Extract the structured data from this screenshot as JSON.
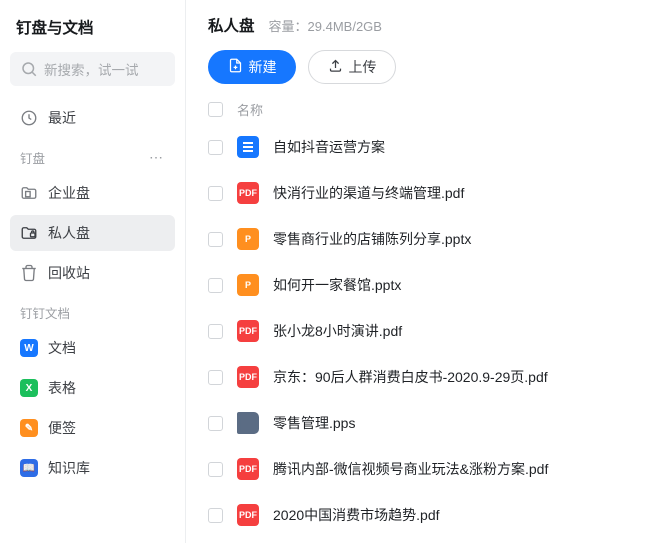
{
  "app_title": "钉盘与文档",
  "search": {
    "placeholder": "新搜索，试一试"
  },
  "nav_recent": "最近",
  "section_drive": "钉盘",
  "nav_enterprise": "企业盘",
  "nav_personal": "私人盘",
  "nav_trash": "回收站",
  "section_docs": "钉钉文档",
  "doc_docs": "文档",
  "doc_sheets": "表格",
  "doc_notes": "便签",
  "doc_wiki": "知识库",
  "main_title": "私人盘",
  "capacity_label": "容量：",
  "capacity_value": "29.4MB/2GB",
  "btn_new": "新建",
  "btn_upload": "上传",
  "col_name": "名称",
  "files": [
    {
      "type": "doc",
      "badge": "",
      "name": "自如抖音运营方案"
    },
    {
      "type": "pdf",
      "badge": "PDF",
      "name": "快消行业的渠道与终端管理.pdf"
    },
    {
      "type": "ppt",
      "badge": "P",
      "name": "零售商行业的店铺陈列分享.pptx"
    },
    {
      "type": "ppt",
      "badge": "P",
      "name": "如何开一家餐馆.pptx"
    },
    {
      "type": "pdf",
      "badge": "PDF",
      "name": "张小龙8小时演讲.pdf"
    },
    {
      "type": "pdf",
      "badge": "PDF",
      "name": "京东：90后人群消费白皮书-2020.9-29页.pdf"
    },
    {
      "type": "pps",
      "badge": "",
      "name": "零售管理.pps"
    },
    {
      "type": "pdf",
      "badge": "PDF",
      "name": "腾讯内部-微信视频号商业玩法&涨粉方案.pdf"
    },
    {
      "type": "pdf",
      "badge": "PDF",
      "name": "2020中国消费市场趋势.pdf"
    }
  ]
}
